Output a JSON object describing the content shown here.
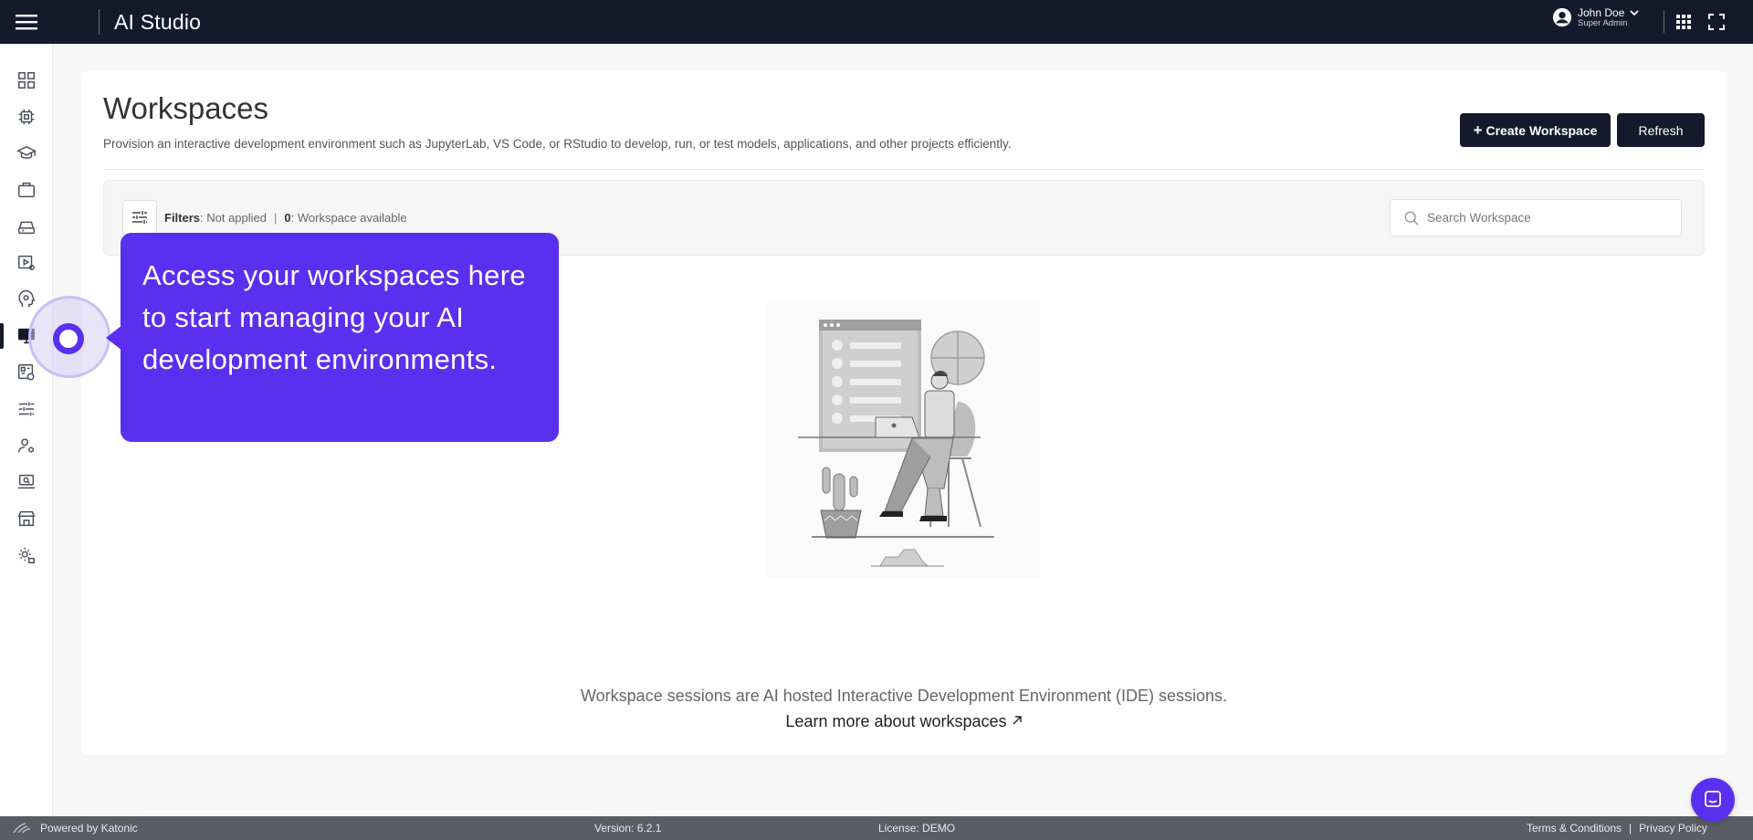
{
  "header": {
    "app_title": "AI Studio",
    "user_name": "John Doe",
    "user_role": "Super Admin"
  },
  "sidebar": {
    "items": [
      {
        "icon": "dashboard-grid-icon"
      },
      {
        "icon": "cpu-chip-icon"
      },
      {
        "icon": "graduation-cap-icon"
      },
      {
        "icon": "briefcase-icon"
      },
      {
        "icon": "storage-drive-icon"
      },
      {
        "icon": "video-settings-icon"
      },
      {
        "icon": "head-gear-icon"
      },
      {
        "icon": "monitor-icon",
        "active": true
      },
      {
        "icon": "dashboard-link-icon"
      },
      {
        "icon": "sliders-icon"
      },
      {
        "icon": "user-settings-icon"
      },
      {
        "icon": "laptop-search-icon"
      },
      {
        "icon": "store-icon"
      },
      {
        "icon": "gear-lock-icon"
      }
    ]
  },
  "page": {
    "title": "Workspaces",
    "description": "Provision an interactive development environment such as JupyterLab, VS Code, or RStudio to develop, run, or test models, applications, and other projects efficiently.",
    "create_button": "Create Workspace",
    "refresh_button": "Refresh"
  },
  "filters": {
    "label": "Filters",
    "status": ": Not applied",
    "count": "0",
    "count_label": ": Workspace available"
  },
  "search": {
    "placeholder": "Search Workspace",
    "value": ""
  },
  "empty_state": {
    "message": "Workspace sessions are AI hosted Interactive Development Environment (IDE) sessions.",
    "link": "Learn more about workspaces"
  },
  "tooltip": {
    "text": "Access your workspaces here to start managing your AI development environments."
  },
  "footer": {
    "powered_by": "Powered by Katonic",
    "version": "Version: 6.2.1",
    "license": "License: DEMO",
    "terms": "Terms & Conditions",
    "privacy": "Privacy Policy"
  },
  "colors": {
    "topbar": "#141a2b",
    "accent": "#5a2ff0",
    "footer": "#5b5d66"
  }
}
